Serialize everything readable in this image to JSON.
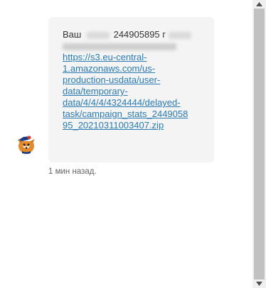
{
  "message": {
    "text_start": "Ваш",
    "partial_number": "244905895 г",
    "link_lines": [
      "https://s3.eu-central-",
      "1.amazonaws.com/us-",
      "production-usdata/user-",
      "data/temporary-",
      "data/4/4/4/4324444/delayed-",
      "task/campaign_stats_2449058",
      "95_20210311003407.zip"
    ],
    "timestamp": "1 мин назад."
  },
  "avatar": {
    "icon": "fox-mascot-icon"
  },
  "colors": {
    "bubble_bg": "#f4f4f4",
    "link": "#2a7ab5",
    "timestamp": "#666666",
    "scrollbar_thumb": "#c1c1c1"
  }
}
